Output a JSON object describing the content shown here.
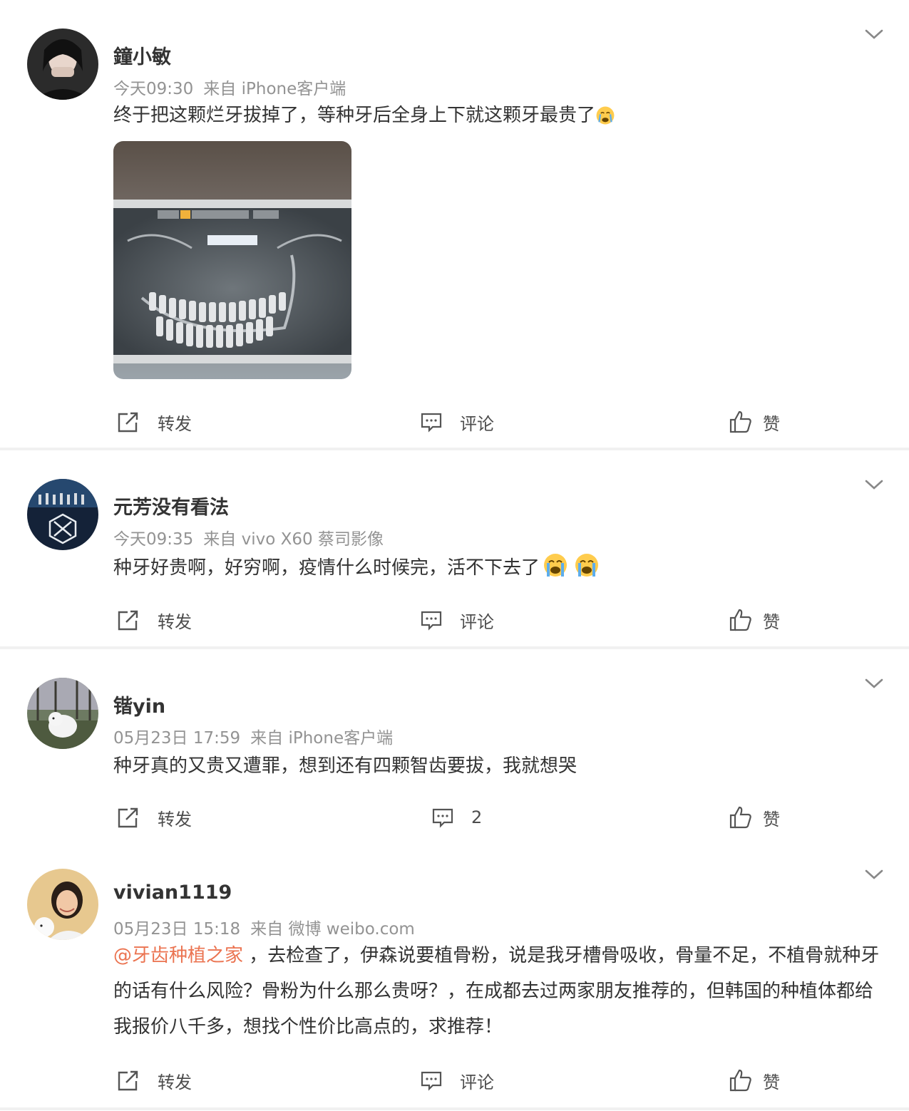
{
  "comments": [
    {
      "name": "鐘小敏",
      "time": "今天09:30",
      "source": "来自 iPhone客户端",
      "text": "终于把这颗烂牙拔掉了，等种牙后全身上下就这颗牙最贵了",
      "emoji": "crying-face",
      "has_image": true,
      "image_desc_icon": "dental-xray-image",
      "actions": {
        "repost": "转发",
        "comment": "评论",
        "like": "赞"
      }
    },
    {
      "name": "元芳没有看法",
      "time": "今天09:35",
      "source": "来自 vivo X60 蔡司影像",
      "text": "种牙好贵啊，好穷啊，疫情什么时候完，活不下去了",
      "emoji": "loudly-crying-face x2",
      "actions": {
        "repost": "转发",
        "comment": "评论",
        "like": "赞"
      }
    },
    {
      "name": "锴yin",
      "time": "05月23日 17:59",
      "source": "来自 iPhone客户端",
      "text": "种牙真的又贵又遭罪，想到还有四颗智齿要拔，我就想哭",
      "actions": {
        "repost": "转发",
        "comment": "2",
        "like": "赞"
      }
    },
    {
      "name": "vivian1119",
      "time": "05月23日 15:18",
      "source": "来自 微博 weibo.com",
      "mention": "@牙齿种植之家",
      "text": " ，去检查了，伊森说要植骨粉，说是我牙槽骨吸收，骨量不足，不植骨就种牙的话有什么风险？骨粉为什么那么贵呀？，在成都去过两家朋友推荐的，但韩国的种植体都给我报价八千多，想找个性价比高点的，求推荐！",
      "actions": {
        "repost": "转发",
        "comment": "评论",
        "like": "赞"
      }
    }
  ],
  "colors": {
    "mention": "#eb7350",
    "meta": "#939393",
    "text": "#333333",
    "separator": "#f1f1f1"
  }
}
